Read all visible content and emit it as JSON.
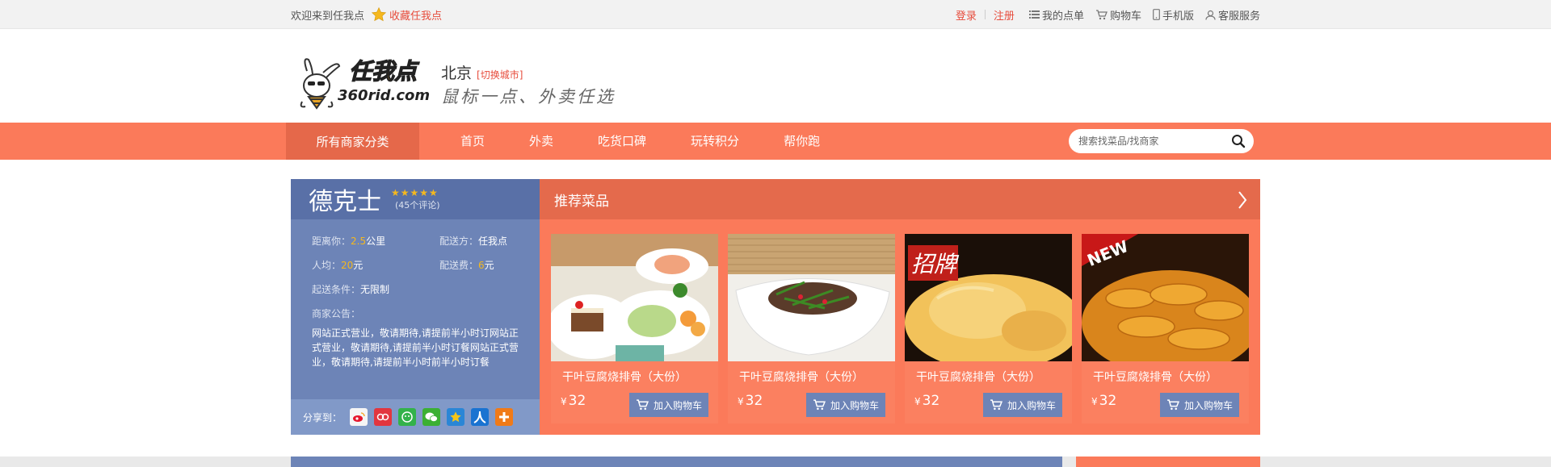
{
  "topbar": {
    "welcome": "欢迎来到任我点",
    "favorite": "收藏任我点",
    "login": "登录",
    "register": "注册",
    "my_orders": "我的点单",
    "cart": "购物车",
    "mobile": "手机版",
    "service": "客服服务"
  },
  "header": {
    "logo_cn": "任我点",
    "logo_en": "360rid.com",
    "city": "北京",
    "switch_city": "[切换城市]",
    "slogan": "鼠标一点、外卖任选"
  },
  "nav": {
    "all_categories": "所有商家分类",
    "items": [
      "首页",
      "外卖",
      "吃货口碑",
      "玩转积分",
      "帮你跑"
    ],
    "search_placeholder": "搜索找菜品/找商家"
  },
  "shop": {
    "name": "德克士",
    "stars": "★★★★★",
    "reviews": "(45个评论)",
    "distance_label": "距离你：",
    "distance_value": "2.5",
    "distance_unit": "公里",
    "delivery_by_label": "配送方：",
    "delivery_by_value": "任我点",
    "avg_label": "人均：",
    "avg_value": "20",
    "avg_unit": "元",
    "fee_label": "配送费：",
    "fee_value": "6",
    "fee_unit": "元",
    "min_label": "起送条件：",
    "min_value": "无限制",
    "notice_label": "商家公告：",
    "notice": "网站正式营业，敬请期待,请提前半小时订网站正式营业，敬请期待,请提前半小时订餐网站正式营业，敬请期待,请提前半小时前半小时订餐",
    "share_label": "分享到："
  },
  "recommend": {
    "title": "推荐菜品",
    "items": [
      {
        "name": "干叶豆腐烧排骨（大份）",
        "currency": "¥",
        "price": "32",
        "add": "加入购物车",
        "badge": ""
      },
      {
        "name": "干叶豆腐烧排骨（大份）",
        "currency": "¥",
        "price": "32",
        "add": "加入购物车",
        "badge": ""
      },
      {
        "name": "干叶豆腐烧排骨（大份）",
        "currency": "¥",
        "price": "32",
        "add": "加入购物车",
        "badge": "招牌"
      },
      {
        "name": "干叶豆腐烧排骨（大份）",
        "currency": "¥",
        "price": "32",
        "add": "加入购物车",
        "badge": "NEW"
      }
    ]
  },
  "colors": {
    "accent": "#fb7a5a",
    "accent_dark": "#e46a4c",
    "blue": "#6d84b7",
    "blue_dark": "#5970a7"
  }
}
